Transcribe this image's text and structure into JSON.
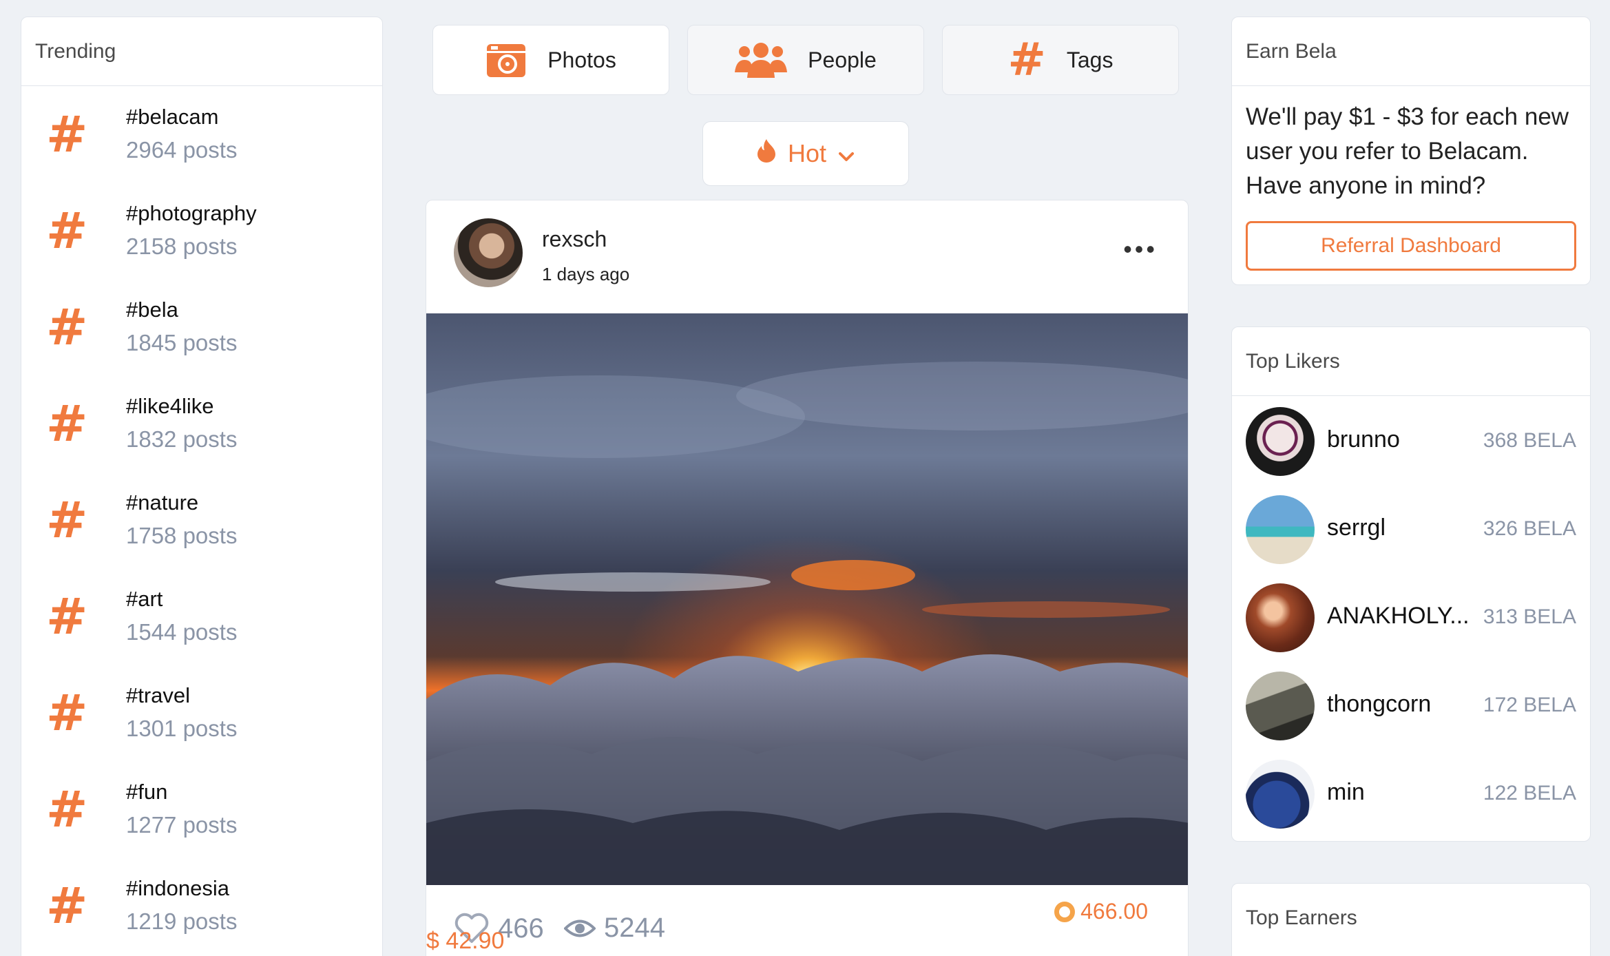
{
  "trending": {
    "title": "Trending",
    "items": [
      {
        "tag": "#belacam",
        "count": "2964 posts"
      },
      {
        "tag": "#photography",
        "count": "2158 posts"
      },
      {
        "tag": "#bela",
        "count": "1845 posts"
      },
      {
        "tag": "#like4like",
        "count": "1832 posts"
      },
      {
        "tag": "#nature",
        "count": "1758 posts"
      },
      {
        "tag": "#art",
        "count": "1544 posts"
      },
      {
        "tag": "#travel",
        "count": "1301 posts"
      },
      {
        "tag": "#fun",
        "count": "1277 posts"
      },
      {
        "tag": "#indonesia",
        "count": "1219 posts"
      }
    ]
  },
  "tabs": {
    "photos": "Photos",
    "people": "People",
    "tags": "Tags"
  },
  "sort": {
    "label": "Hot"
  },
  "post": {
    "username": "rexsch",
    "time": "1 days ago",
    "likes": "466",
    "views": "5244",
    "bela_earned": "466.00",
    "usd_earned": "$ 42.90"
  },
  "earn": {
    "title": "Earn Bela",
    "text": "We'll pay $1 - $3 for each new user you refer to Belacam. Have anyone in mind?",
    "button": "Referral Dashboard"
  },
  "top_likers": {
    "title": "Top Likers",
    "items": [
      {
        "name": "brunno",
        "amount": "368 BELA"
      },
      {
        "name": "serrgl",
        "amount": "326 BELA"
      },
      {
        "name": "ANAKHOLY...",
        "amount": "313 BELA"
      },
      {
        "name": "thongcorn",
        "amount": "172 BELA"
      },
      {
        "name": "min",
        "amount": "122 BELA"
      }
    ]
  },
  "top_earners": {
    "title": "Top Earners"
  },
  "colors": {
    "accent": "#f07a3e",
    "muted": "#8a94a6",
    "background": "#eef1f5"
  }
}
